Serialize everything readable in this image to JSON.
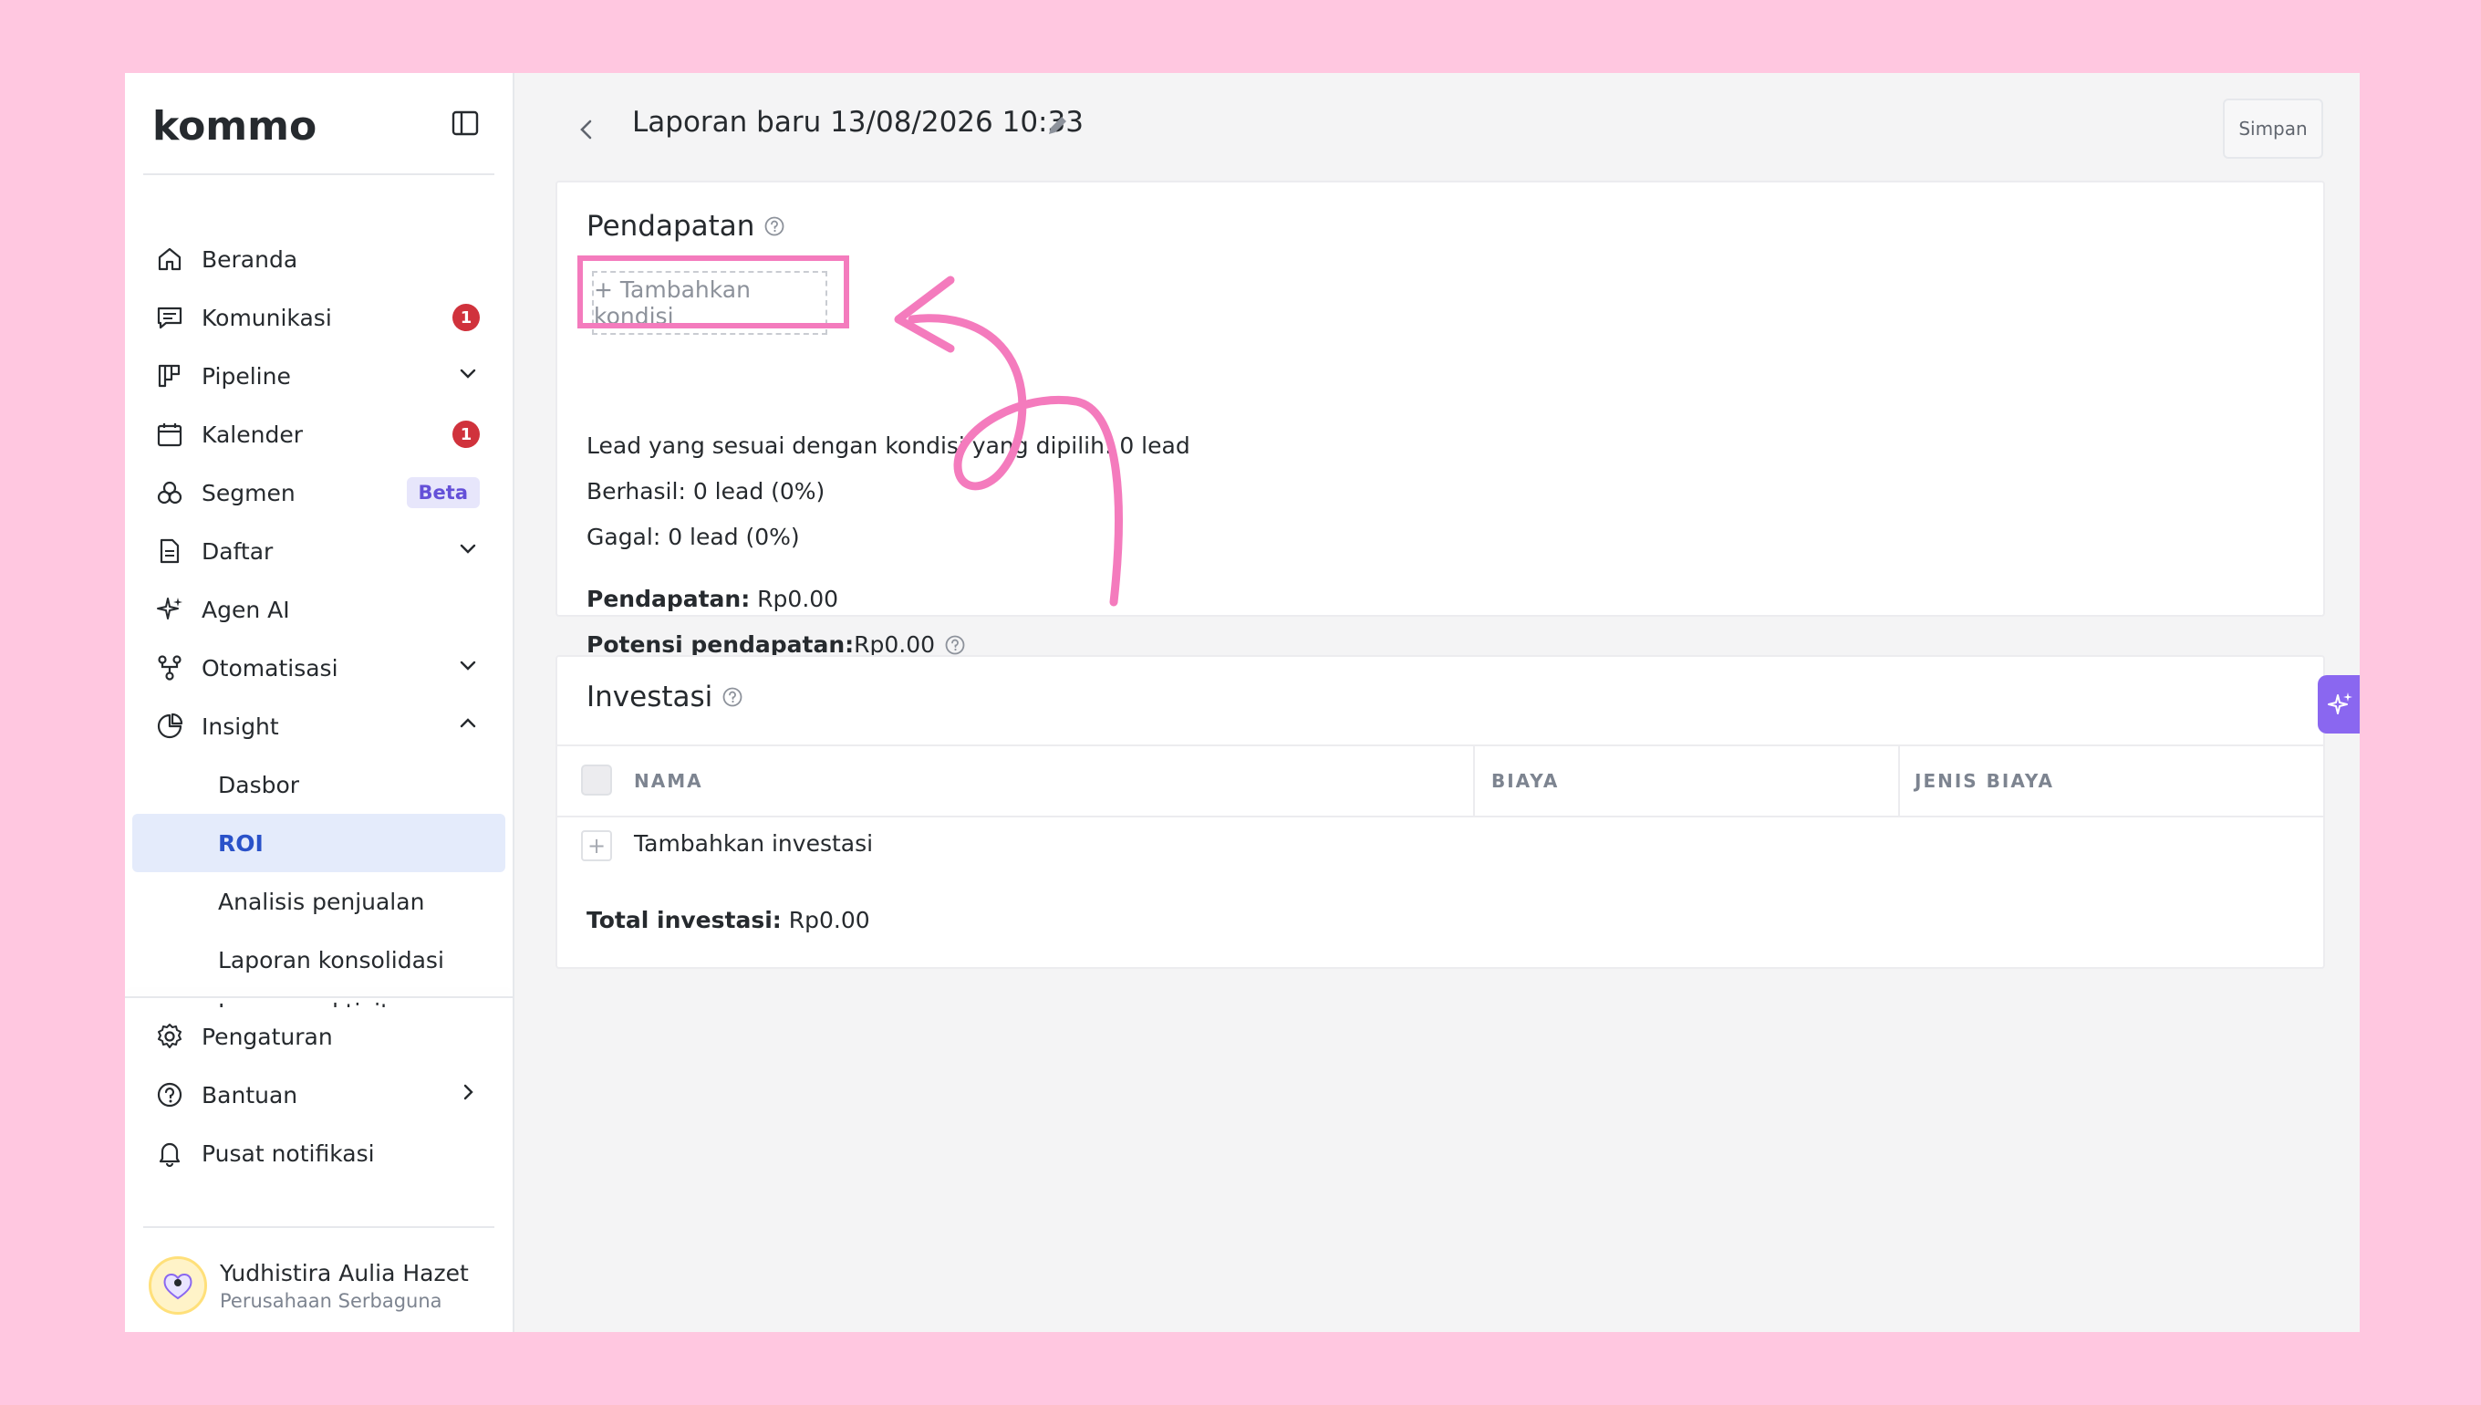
{
  "brand": {
    "logo_text": "kommo"
  },
  "sidebar": {
    "items": [
      {
        "label": "Beranda",
        "icon": "home-icon"
      },
      {
        "label": "Komunikasi",
        "icon": "chat-icon",
        "badge": "1"
      },
      {
        "label": "Pipeline",
        "icon": "pipeline-icon",
        "chevron": "down"
      },
      {
        "label": "Kalender",
        "icon": "calendar-icon",
        "badge": "1"
      },
      {
        "label": "Segmen",
        "icon": "segments-icon",
        "tag": "Beta"
      },
      {
        "label": "Daftar",
        "icon": "document-icon",
        "chevron": "down"
      },
      {
        "label": "Agen AI",
        "icon": "sparkle-icon"
      },
      {
        "label": "Otomatisasi",
        "icon": "automation-icon",
        "chevron": "down"
      },
      {
        "label": "Insight",
        "icon": "pie-chart-icon",
        "chevron": "up"
      }
    ],
    "insight_sub": [
      "Dasbor",
      "ROI",
      "Analisis penjualan",
      "Laporan konsolidasi",
      "Laporan aktivitas"
    ],
    "active_sub": "ROI",
    "bottom": [
      {
        "label": "Pengaturan",
        "icon": "gear-icon"
      },
      {
        "label": "Bantuan",
        "icon": "help-icon",
        "chevron": "right"
      },
      {
        "label": "Pusat notifikasi",
        "icon": "bell-icon"
      }
    ],
    "user": {
      "name": "Yudhistira Aulia Hazet",
      "org": "Perusahaan Serbaguna"
    }
  },
  "header": {
    "title": "Laporan baru 13/08/2026 10:33",
    "save_label": "Simpan"
  },
  "revenue": {
    "title": "Pendapatan",
    "add_condition": "+ Tambahkan kondisi",
    "matching": "Lead yang sesuai dengan kondisi yang dipilih: 0 lead",
    "success": "Berhasil: 0 lead (0%)",
    "failed": "Gagal: 0 lead (0%)",
    "revenue_label": "Pendapatan:",
    "revenue_value": " Rp0.00",
    "potential_label": "Potensi pendapatan:",
    "potential_value": " Rp0.00"
  },
  "investment": {
    "title": "Investasi",
    "columns": [
      "NAMA",
      "BIAYA",
      "JENIS BIAYA"
    ],
    "add_label": "Tambahkan investasi",
    "total_label": "Total investasi:",
    "total_value": " Rp0.00"
  },
  "annotation": {
    "color": "#f47bbd"
  }
}
